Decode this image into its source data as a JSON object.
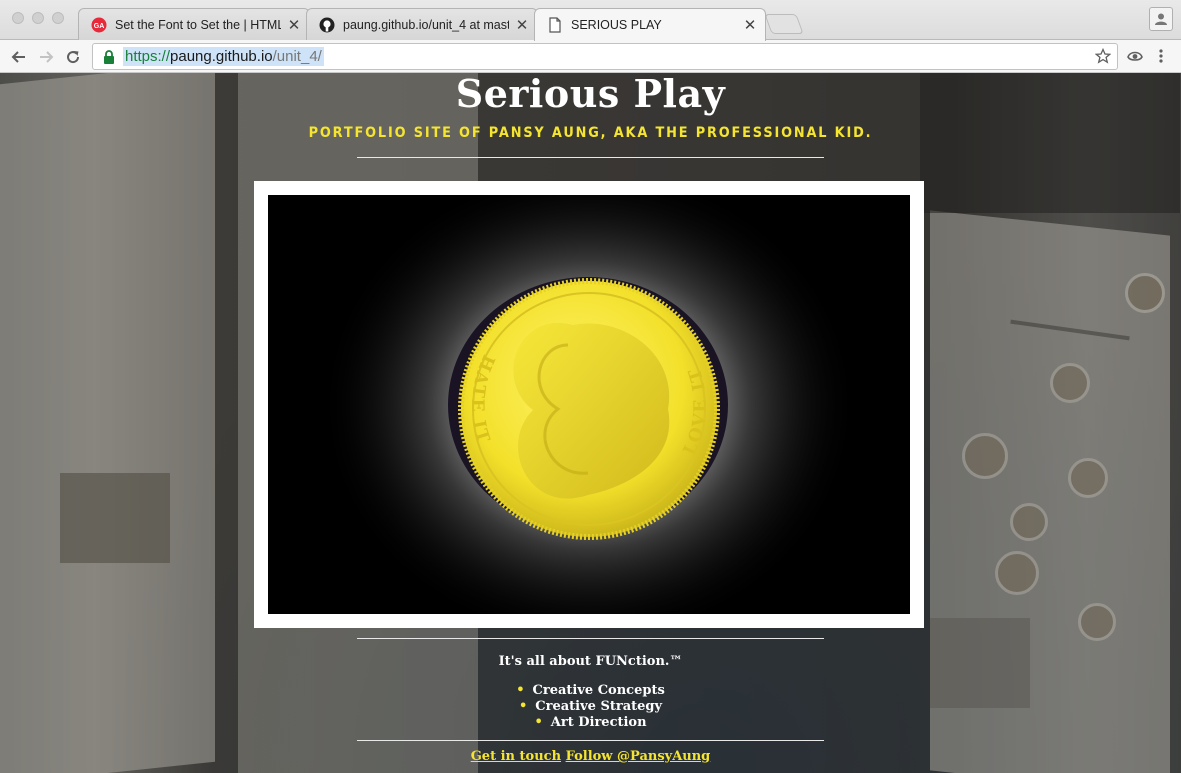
{
  "browser": {
    "tabs": [
      {
        "title": "Set the Font to Set the | HTML",
        "icon": "ga-icon",
        "active": false
      },
      {
        "title": "paung.github.io/unit_4 at mast",
        "icon": "github-icon",
        "active": false
      },
      {
        "title": "SERIOUS PLAY",
        "icon": "page-icon",
        "active": true
      }
    ],
    "close_glyph": "✕",
    "url": {
      "scheme": "https://",
      "host": "paung.github.io",
      "path": "/unit_4/"
    }
  },
  "page": {
    "title": "Serious Play",
    "tagline": "PORTFOLIO SITE OF PANSY AUNG, AKA THE PROFESSIONAL KID.",
    "hero": {
      "left_text": "HATE IT",
      "right_text": "LOVE IT",
      "coin_color": "#f3e02a"
    },
    "intro": "It's all about FUNction.™",
    "skills": [
      "Creative Concepts",
      "Creative Strategy",
      "Art Direction"
    ],
    "links": {
      "contact": "Get in touch",
      "follow": "Follow @PansyAung"
    },
    "accent_color": "#f5e530"
  }
}
